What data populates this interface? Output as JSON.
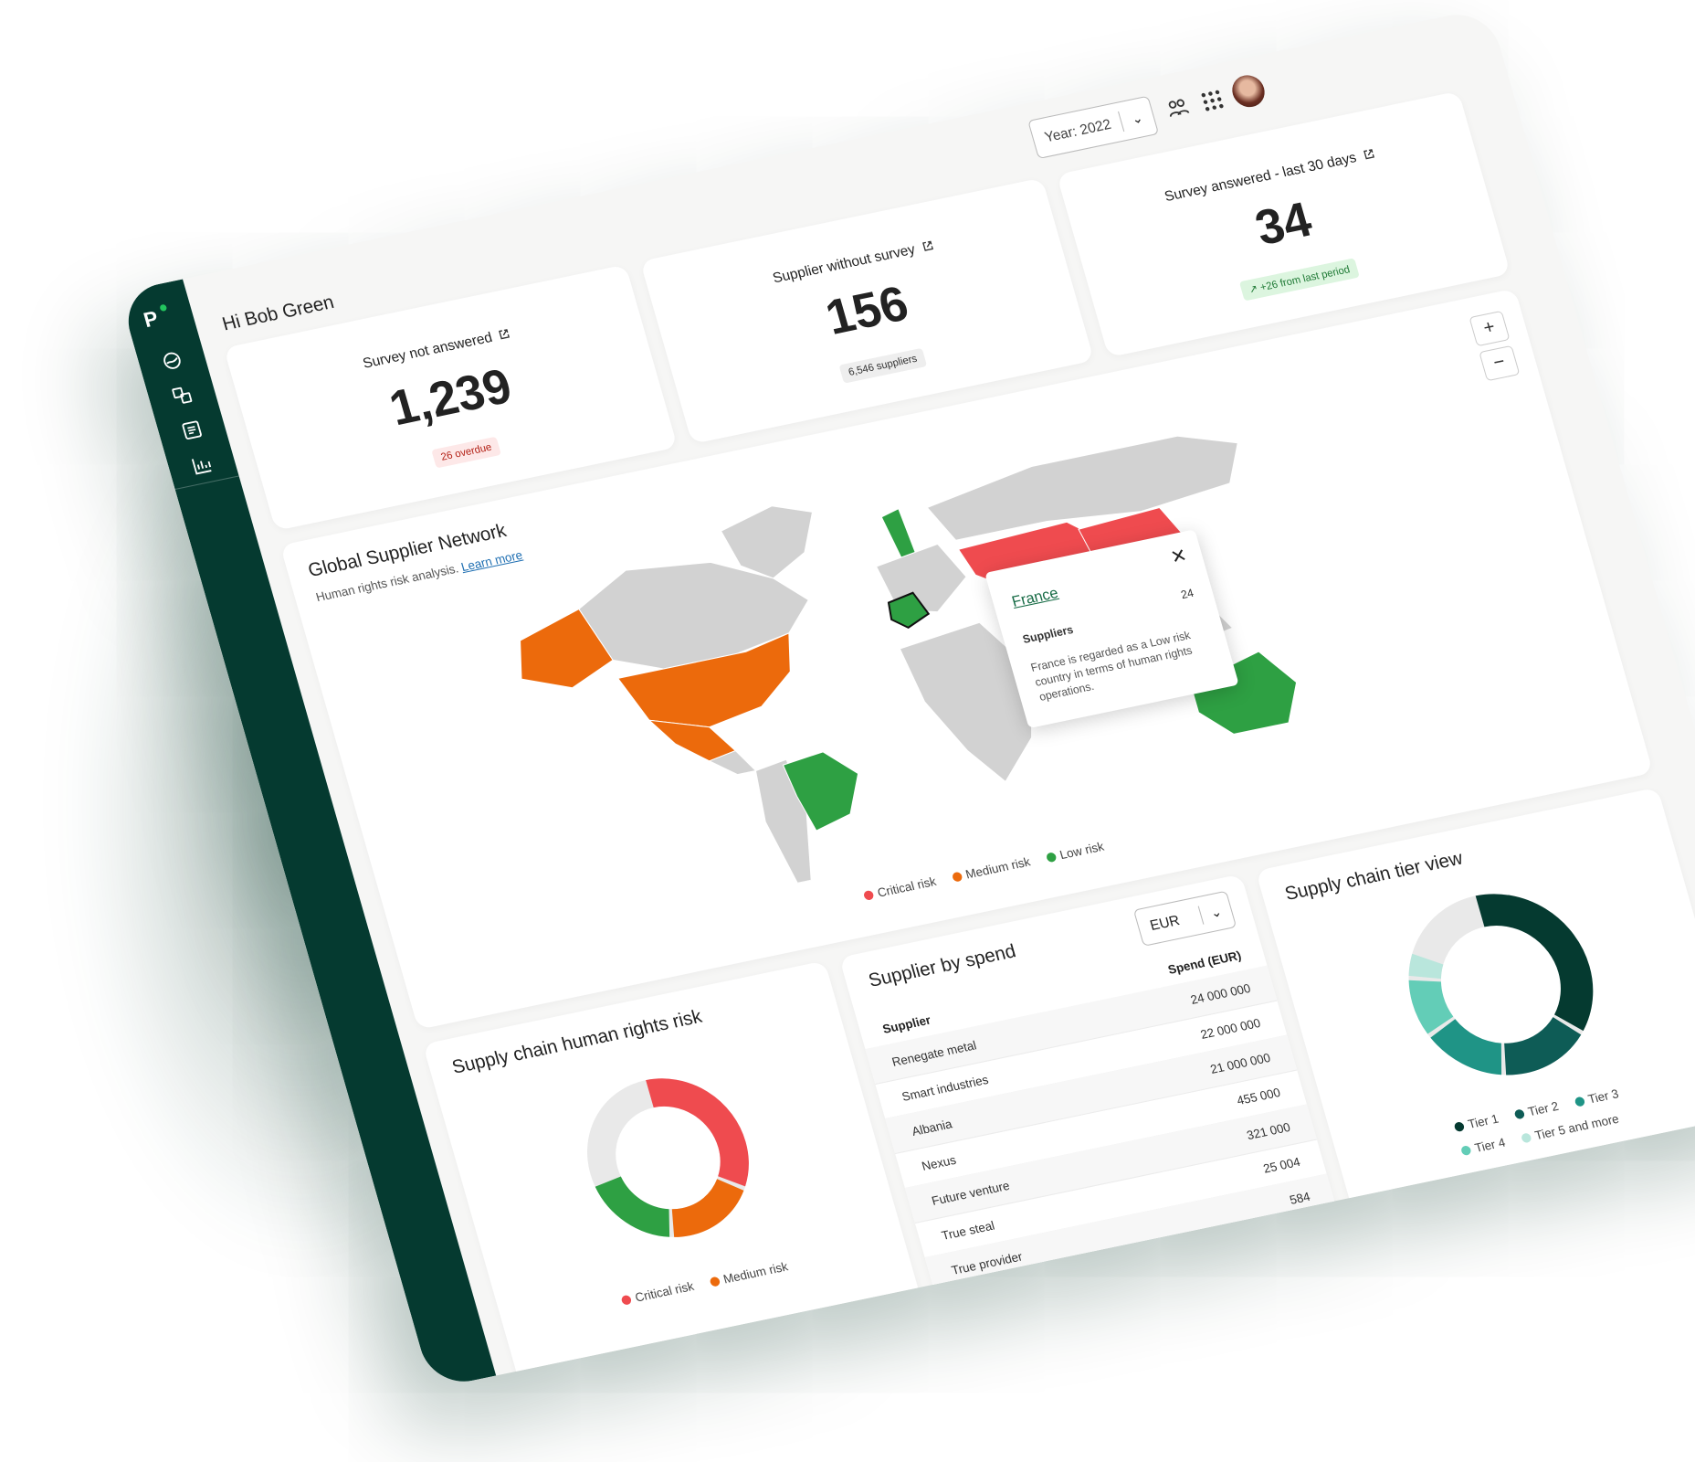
{
  "header": {
    "greeting": "Hi Bob Green",
    "year_select": "Year: 2022"
  },
  "kpis": [
    {
      "title": "Survey not answered",
      "value": "1,239",
      "badge": "26 overdue"
    },
    {
      "title": "Supplier without survey",
      "value": "156",
      "badge": "6,546 suppliers"
    },
    {
      "title": "Survey answered - last 30 days",
      "value": "34",
      "badge": "+26 from last period"
    }
  ],
  "map": {
    "title": "Global Supplier Network",
    "subtitle": "Human rights risk analysis.",
    "learn_more": "Learn more",
    "zoom_in": "+",
    "zoom_out": "−",
    "legend": [
      {
        "label": "Critical risk",
        "color": "#ef4b4f"
      },
      {
        "label": "Medium risk",
        "color": "#ec6a0c"
      },
      {
        "label": "Low risk",
        "color": "#2ea043"
      }
    ],
    "popup": {
      "country": "France",
      "label": "Suppliers",
      "value": "24",
      "description": "France is regarded as a Low risk country in terms of human rights operations."
    }
  },
  "human_rights": {
    "title": "Supply chain human rights risk",
    "legend": [
      {
        "label": "Critical risk",
        "color": "#ef4b4f"
      },
      {
        "label": "Medium risk",
        "color": "#ec6a0c"
      }
    ]
  },
  "spend": {
    "title": "Supplier by spend",
    "currency": "EUR",
    "col_supplier": "Supplier",
    "col_spend": "Spend (EUR)",
    "rows": [
      {
        "supplier": "Renegate metal",
        "spend": "24 000 000"
      },
      {
        "supplier": "Smart industries",
        "spend": "22 000 000"
      },
      {
        "supplier": "Albania",
        "spend": "21 000 000"
      },
      {
        "supplier": "Nexus",
        "spend": "455 000"
      },
      {
        "supplier": "Future venture",
        "spend": "321 000"
      },
      {
        "supplier": "True steal",
        "spend": "25 004"
      },
      {
        "supplier": "True provider",
        "spend": "584"
      }
    ]
  },
  "tiers": {
    "title": "Supply chain tier view",
    "legend": [
      {
        "label": "Tier 1",
        "color": "#053a30"
      },
      {
        "label": "Tier 2",
        "color": "#0e5c56"
      },
      {
        "label": "Tier 3",
        "color": "#1f9486"
      },
      {
        "label": "Tier 4",
        "color": "#63cdb7"
      },
      {
        "label": "Tier 5 and more",
        "color": "#b9e6dc"
      }
    ]
  }
}
